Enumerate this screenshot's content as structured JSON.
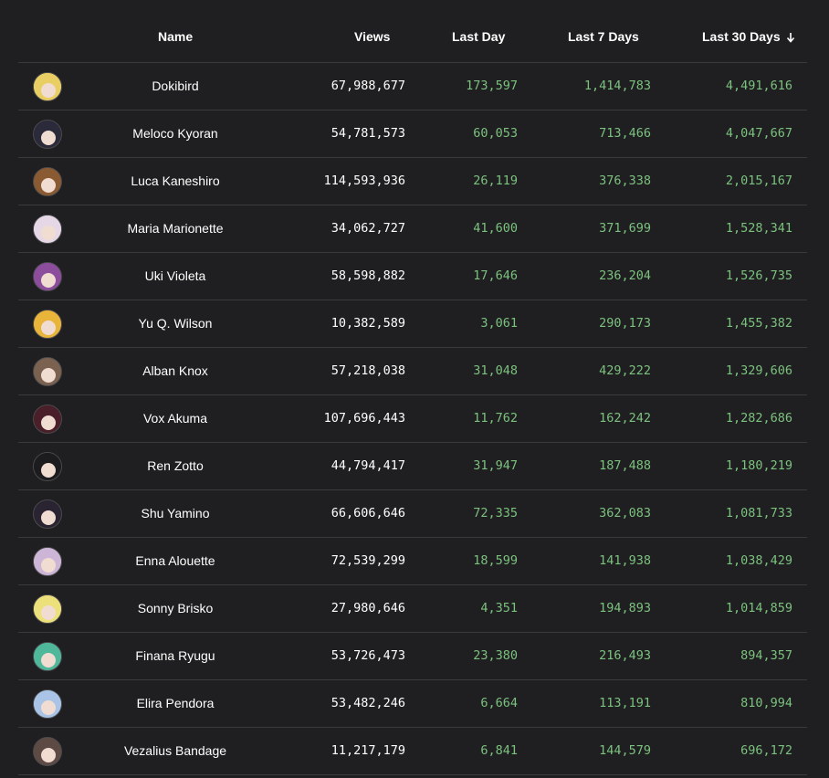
{
  "headers": {
    "name": "Name",
    "views": "Views",
    "last_day": "Last Day",
    "last_7": "Last 7 Days",
    "last_30": "Last 30 Days",
    "sort_icon": "arrow-down-icon"
  },
  "colors": {
    "background": "#1f1f21",
    "divider": "#3a3a3d",
    "positive": "#7cc27f",
    "text": "#ffffff"
  },
  "rows": [
    {
      "name": "Dokibird",
      "views": "67,988,677",
      "day": "173,597",
      "week": "1,414,783",
      "month": "4,491,616",
      "avatar_color": "#e9cf63"
    },
    {
      "name": "Meloco Kyoran",
      "views": "54,781,573",
      "day": "60,053",
      "week": "713,466",
      "month": "4,047,667",
      "avatar_color": "#2b2a3a"
    },
    {
      "name": "Luca Kaneshiro",
      "views": "114,593,936",
      "day": "26,119",
      "week": "376,338",
      "month": "2,015,167",
      "avatar_color": "#8a5a33"
    },
    {
      "name": "Maria Marionette",
      "views": "34,062,727",
      "day": "41,600",
      "week": "371,699",
      "month": "1,528,341",
      "avatar_color": "#e6d7e6"
    },
    {
      "name": "Uki Violeta",
      "views": "58,598,882",
      "day": "17,646",
      "week": "236,204",
      "month": "1,526,735",
      "avatar_color": "#8b4d9c"
    },
    {
      "name": "Yu Q. Wilson",
      "views": "10,382,589",
      "day": "3,061",
      "week": "290,173",
      "month": "1,455,382",
      "avatar_color": "#e8b43a"
    },
    {
      "name": "Alban Knox",
      "views": "57,218,038",
      "day": "31,048",
      "week": "429,222",
      "month": "1,329,606",
      "avatar_color": "#7a6150"
    },
    {
      "name": "Vox Akuma",
      "views": "107,696,443",
      "day": "11,762",
      "week": "162,242",
      "month": "1,282,686",
      "avatar_color": "#4a1f2a"
    },
    {
      "name": "Ren Zotto",
      "views": "44,794,417",
      "day": "31,947",
      "week": "187,488",
      "month": "1,180,219",
      "avatar_color": "#1c1c1f"
    },
    {
      "name": "Shu Yamino",
      "views": "66,606,646",
      "day": "72,335",
      "week": "362,083",
      "month": "1,081,733",
      "avatar_color": "#2a2432"
    },
    {
      "name": "Enna Alouette",
      "views": "72,539,299",
      "day": "18,599",
      "week": "141,938",
      "month": "1,038,429",
      "avatar_color": "#cdb5d8"
    },
    {
      "name": "Sonny Brisko",
      "views": "27,980,646",
      "day": "4,351",
      "week": "194,893",
      "month": "1,014,859",
      "avatar_color": "#ece07a"
    },
    {
      "name": "Finana Ryugu",
      "views": "53,726,473",
      "day": "23,380",
      "week": "216,493",
      "month": "894,357",
      "avatar_color": "#4fb89a"
    },
    {
      "name": "Elira Pendora",
      "views": "53,482,246",
      "day": "6,664",
      "week": "113,191",
      "month": "810,994",
      "avatar_color": "#a9c4e6"
    },
    {
      "name": "Vezalius Bandage",
      "views": "11,217,179",
      "day": "6,841",
      "week": "144,579",
      "month": "696,172",
      "avatar_color": "#5d4a44"
    }
  ]
}
